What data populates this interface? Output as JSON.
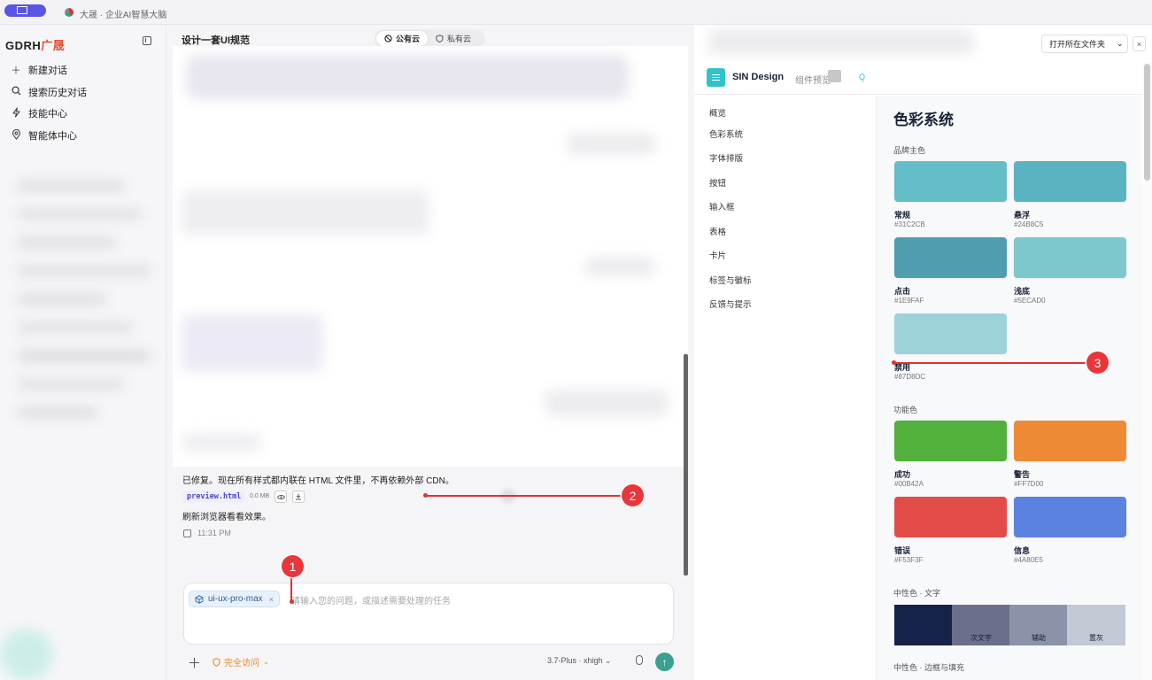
{
  "tab": {
    "title": "大晟 · 企业AI智慧大脑"
  },
  "sidebar": {
    "brand_a": "GDRH",
    "brand_b": "广晟",
    "items": [
      {
        "label": "新建对话",
        "icon": "plus-icon"
      },
      {
        "label": "搜索历史对话",
        "icon": "search-icon"
      },
      {
        "label": "技能中心",
        "icon": "lightning-icon"
      },
      {
        "label": "智能体中心",
        "icon": "location-pin-icon"
      }
    ]
  },
  "chat": {
    "title": "设计一套UI规范",
    "cloud_options": [
      "公有云",
      "私有云"
    ],
    "message_1": "已修复。现在所有样式都内联在 HTML 文件里，不再依赖外部 CDN。",
    "file_name": "preview.html",
    "file_size": "0.0 MB",
    "message_2": "刷新浏览器看看效果。",
    "time": "11:31 PM"
  },
  "input": {
    "skill_chip": "ui-ux-pro-max",
    "placeholder": "请输入您的问题，或描述需要处理的任务",
    "access_label": "完全访问",
    "model_label": "3.7-Plus · xhigh"
  },
  "preview_toolbar": {
    "open_folder": "打开所在文件夹"
  },
  "preview": {
    "brand": "SIN Design",
    "subtitle": "组件预览",
    "nav": [
      "概览",
      "色彩系统",
      "字体排版",
      "按钮",
      "输入框",
      "表格",
      "卡片",
      "标签与徽标",
      "反馈与提示"
    ],
    "title": "色彩系统",
    "brand_section": "品牌主色",
    "brand_swatches": [
      {
        "name": "常规",
        "hex": "#31C2CB",
        "color": "#63bec8"
      },
      {
        "name": "悬浮",
        "hex": "#24B8C5",
        "color": "#5ab3c0"
      },
      {
        "name": "点击",
        "hex": "#1E9FAF",
        "color": "#4f9daf"
      },
      {
        "name": "浅底",
        "hex": "#5ECAD0",
        "color": "#7cc8cc"
      },
      {
        "name": "禁用",
        "hex": "#87D8DC",
        "color": "#9cd3db"
      }
    ],
    "func_section": "功能色",
    "func_swatches": [
      {
        "name": "成功",
        "hex": "#00B42A",
        "color": "#52b03c"
      },
      {
        "name": "警告",
        "hex": "#FF7D00",
        "color": "#ee8a36"
      },
      {
        "name": "错误",
        "hex": "#F53F3F",
        "color": "#e24c48"
      },
      {
        "name": "信息",
        "hex": "#4A80E5",
        "color": "#5b82df"
      }
    ],
    "neutral_text_section": "中性色 · 文字",
    "neutral_text": [
      {
        "label": "",
        "color": "#17224a"
      },
      {
        "label": "次文字",
        "color": "#6c6f8c"
      },
      {
        "label": "辅助",
        "color": "#8a93a8"
      },
      {
        "label": "置灰",
        "color": "#c2c9d4"
      }
    ],
    "neutral_border_section": "中性色 · 边框与填充"
  },
  "annotations": [
    "1",
    "2",
    "3"
  ]
}
